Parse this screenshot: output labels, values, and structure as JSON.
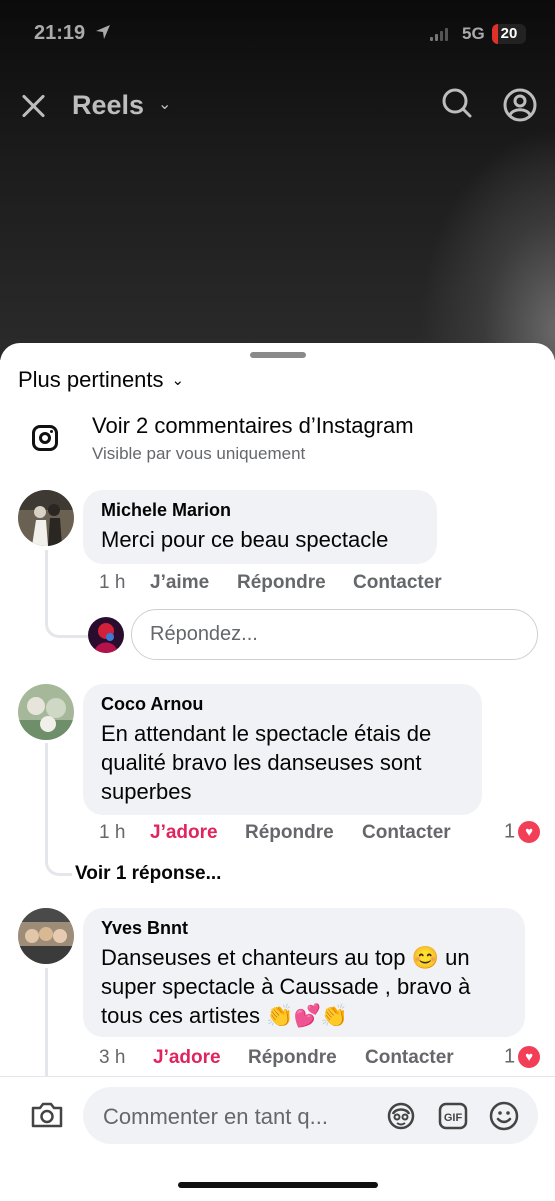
{
  "status_bar": {
    "time": "21:19",
    "network": "5G",
    "battery": "20"
  },
  "header": {
    "title": "Reels"
  },
  "sort": {
    "label": "Plus pertinents"
  },
  "instagram": {
    "title": "Voir 2 commentaires d’Instagram",
    "subtitle": "Visible par vous uniquement"
  },
  "comments": [
    {
      "author": "Michele Marion",
      "text": "Merci pour ce beau spectacle",
      "time": "1 h",
      "like": "J’aime",
      "reply": "Répondre",
      "contact": "Contacter"
    },
    {
      "author": "Coco Arnou",
      "text": "En attendant le spectacle étais de qualité bravo les danseuses sont superbes",
      "time": "1 h",
      "like": "J’adore",
      "reply": "Répondre",
      "contact": "Contacter",
      "reaction_count": "1",
      "see_replies": "Voir 1 réponse..."
    },
    {
      "author": "Yves Bnnt",
      "text": "Danseuses et chanteurs au top 😊 un super spectacle à Caussade , bravo à tous ces artistes 👏💕👏",
      "time": "3 h",
      "like": "J’adore",
      "reply": "Répondre",
      "contact": "Contacter",
      "reaction_count": "1"
    }
  ],
  "reply_box": {
    "placeholder": "Répondez..."
  },
  "composer": {
    "placeholder": "Commenter en tant q..."
  },
  "icons": {
    "close": "close-icon",
    "search": "search-icon",
    "profile": "profile-icon",
    "instagram": "instagram-icon",
    "camera": "camera-icon",
    "avatar_sticker": "avatar-sticker-icon",
    "gif": "gif-icon",
    "emoji": "emoji-icon",
    "heart": "heart-icon"
  },
  "colors": {
    "love": "#e0245e",
    "heart_badge": "#f33e58",
    "bubble": "#f0f2f5"
  }
}
